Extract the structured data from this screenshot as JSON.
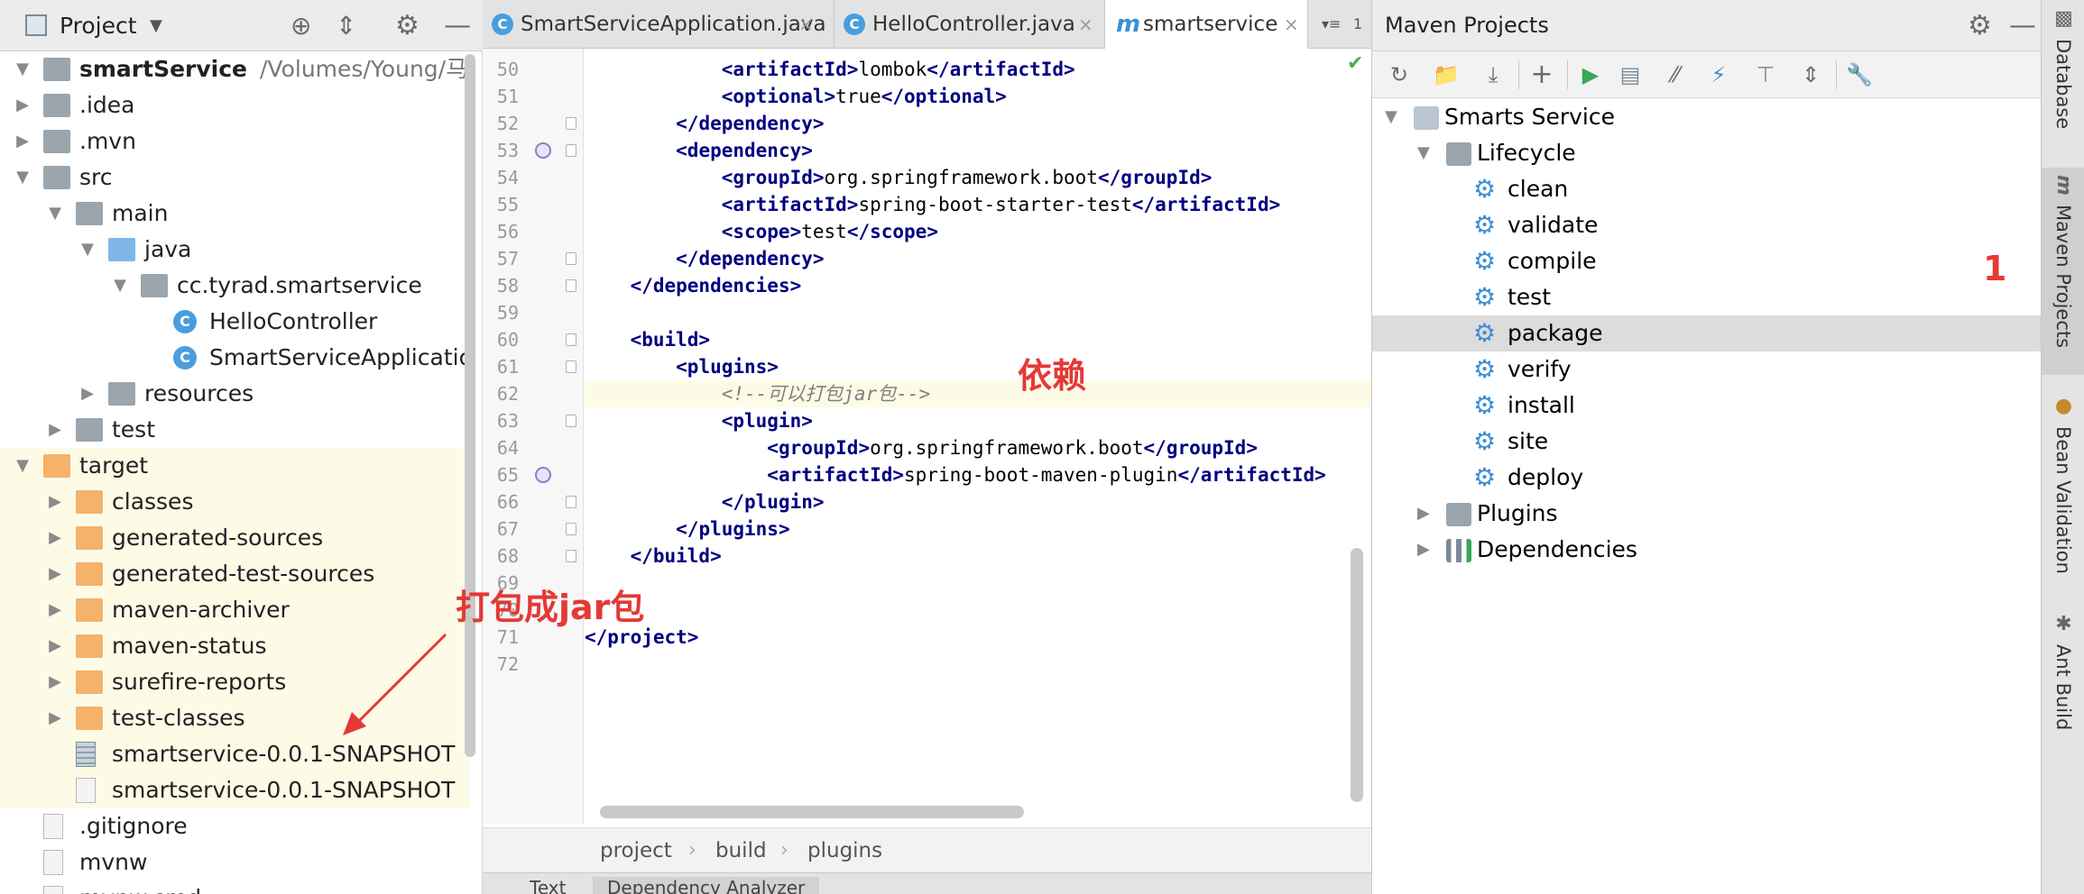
{
  "project": {
    "title": "Project",
    "tree": [
      {
        "label": "smartService",
        "suffix": "/Volumes/Young/马甲",
        "kind": "module",
        "depth": 0,
        "arrow": "down",
        "bold": true
      },
      {
        "label": ".idea",
        "kind": "folder-grey",
        "depth": 0,
        "arrow": "right"
      },
      {
        "label": ".mvn",
        "kind": "folder-grey",
        "depth": 0,
        "arrow": "right"
      },
      {
        "label": "src",
        "kind": "folder-grey",
        "depth": 0,
        "arrow": "down"
      },
      {
        "label": "main",
        "kind": "folder-grey",
        "depth": 1,
        "arrow": "down"
      },
      {
        "label": "java",
        "kind": "folder-blue",
        "depth": 2,
        "arrow": "down"
      },
      {
        "label": "cc.tyrad.smartservice",
        "kind": "package",
        "depth": 3,
        "arrow": "down"
      },
      {
        "label": "HelloController",
        "kind": "class",
        "depth": 4,
        "arrow": ""
      },
      {
        "label": "SmartServiceApplicatio",
        "kind": "class",
        "depth": 4,
        "arrow": ""
      },
      {
        "label": "resources",
        "kind": "resources",
        "depth": 2,
        "arrow": "right"
      },
      {
        "label": "test",
        "kind": "folder-grey",
        "depth": 1,
        "arrow": "right"
      },
      {
        "label": "target",
        "kind": "folder-orange",
        "depth": 0,
        "arrow": "down",
        "hl": true
      },
      {
        "label": "classes",
        "kind": "folder-orange",
        "depth": 1,
        "arrow": "right",
        "hl": true
      },
      {
        "label": "generated-sources",
        "kind": "folder-orange",
        "depth": 1,
        "arrow": "right",
        "hl": true
      },
      {
        "label": "generated-test-sources",
        "kind": "folder-orange",
        "depth": 1,
        "arrow": "right",
        "hl": true
      },
      {
        "label": "maven-archiver",
        "kind": "folder-orange",
        "depth": 1,
        "arrow": "right",
        "hl": true
      },
      {
        "label": "maven-status",
        "kind": "folder-orange",
        "depth": 1,
        "arrow": "right",
        "hl": true
      },
      {
        "label": "surefire-reports",
        "kind": "folder-orange",
        "depth": 1,
        "arrow": "right",
        "hl": true
      },
      {
        "label": "test-classes",
        "kind": "folder-orange",
        "depth": 1,
        "arrow": "right",
        "hl": true
      },
      {
        "label": "smartservice-0.0.1-SNAPSHOT",
        "kind": "jar",
        "depth": 1,
        "arrow": "",
        "hl": true
      },
      {
        "label": "smartservice-0.0.1-SNAPSHOT",
        "kind": "file",
        "depth": 1,
        "arrow": "",
        "hl": true
      },
      {
        "label": ".gitignore",
        "kind": "file",
        "depth": 0,
        "arrow": ""
      },
      {
        "label": "mvnw",
        "kind": "file",
        "depth": 0,
        "arrow": ""
      },
      {
        "label": "mvnw.cmd",
        "kind": "file",
        "depth": 0,
        "arrow": ""
      }
    ]
  },
  "editor": {
    "tabs": [
      {
        "label": "SmartServiceApplication.java",
        "icon": "class-icon",
        "active": false
      },
      {
        "label": "HelloController.java",
        "icon": "class-icon",
        "active": false
      },
      {
        "label": "smartservice",
        "icon": "maven-icon",
        "active": true
      }
    ],
    "tab_overflow": "1",
    "lines": [
      {
        "no": "50",
        "html": "            <span class='t'>&lt;artifactId&gt;</span>lombok<span class='t'>&lt;/artifactId&gt;</span>"
      },
      {
        "no": "51",
        "html": "            <span class='t'>&lt;optional&gt;</span>true<span class='t'>&lt;/optional&gt;</span>"
      },
      {
        "no": "52",
        "html": "        <span class='t'>&lt;/dependency&gt;</span>"
      },
      {
        "no": "53",
        "html": "        <span class='t'>&lt;dependency&gt;</span>"
      },
      {
        "no": "54",
        "html": "            <span class='t'>&lt;groupId&gt;</span>org.springframework.boot<span class='t'>&lt;/groupId&gt;</span>"
      },
      {
        "no": "55",
        "html": "            <span class='t'>&lt;artifactId&gt;</span>spring-boot-starter-test<span class='t'>&lt;/artifactId&gt;</span>"
      },
      {
        "no": "56",
        "html": "            <span class='t'>&lt;scope&gt;</span>test<span class='t'>&lt;/scope&gt;</span>"
      },
      {
        "no": "57",
        "html": "        <span class='t'>&lt;/dependency&gt;</span>"
      },
      {
        "no": "58",
        "html": "    <span class='t'>&lt;/dependencies&gt;</span>"
      },
      {
        "no": "59",
        "html": ""
      },
      {
        "no": "60",
        "html": "    <span class='t'>&lt;build&gt;</span>"
      },
      {
        "no": "61",
        "html": "        <span class='t'>&lt;plugins&gt;</span>"
      },
      {
        "no": "62",
        "html": "            <span class='c'>&lt;!--可以打包jar包--&gt;</span>",
        "cur": true
      },
      {
        "no": "63",
        "html": "            <span class='t'>&lt;plugin&gt;</span>"
      },
      {
        "no": "64",
        "html": "                <span class='t'>&lt;groupId&gt;</span>org.springframework.boot<span class='t'>&lt;/groupId&gt;</span>"
      },
      {
        "no": "65",
        "html": "                <span class='t'>&lt;artifactId&gt;</span>spring-boot-maven-plugin<span class='t'>&lt;/artifactId&gt;</span>"
      },
      {
        "no": "66",
        "html": "            <span class='t'>&lt;/plugin&gt;</span>"
      },
      {
        "no": "67",
        "html": "        <span class='t'>&lt;/plugins&gt;</span>"
      },
      {
        "no": "68",
        "html": "    <span class='t'>&lt;/build&gt;</span>"
      },
      {
        "no": "69",
        "html": ""
      },
      {
        "no": "70",
        "html": ""
      },
      {
        "no": "71",
        "html": "<span class='t'>&lt;/project&gt;</span>"
      },
      {
        "no": "72",
        "html": ""
      }
    ],
    "breadcrumbs": [
      "project",
      "build",
      "plugins"
    ],
    "bottom_tabs": [
      "Text",
      "Dependency Analyzer"
    ]
  },
  "maven": {
    "title": "Maven Projects",
    "root": "Smarts Service",
    "lifecycle_label": "Lifecycle",
    "phases": [
      "clean",
      "validate",
      "compile",
      "test",
      "package",
      "verify",
      "install",
      "site",
      "deploy"
    ],
    "selected_phase": "package",
    "plugins_label": "Plugins",
    "dependencies_label": "Dependencies"
  },
  "tool_strip": [
    "Database",
    "Maven Projects",
    "Bean Validation",
    "Ant Build"
  ],
  "annotations": {
    "jar_note": "打包成jar包",
    "dependency_note": "依赖",
    "step_number": "1"
  },
  "colors": {
    "annotation_red": "#e53935",
    "xml_tag": "#000080",
    "highlight_row": "#fdfbe6",
    "selected_row": "#dcdcdc",
    "gear_blue": "#3b8fd8"
  }
}
